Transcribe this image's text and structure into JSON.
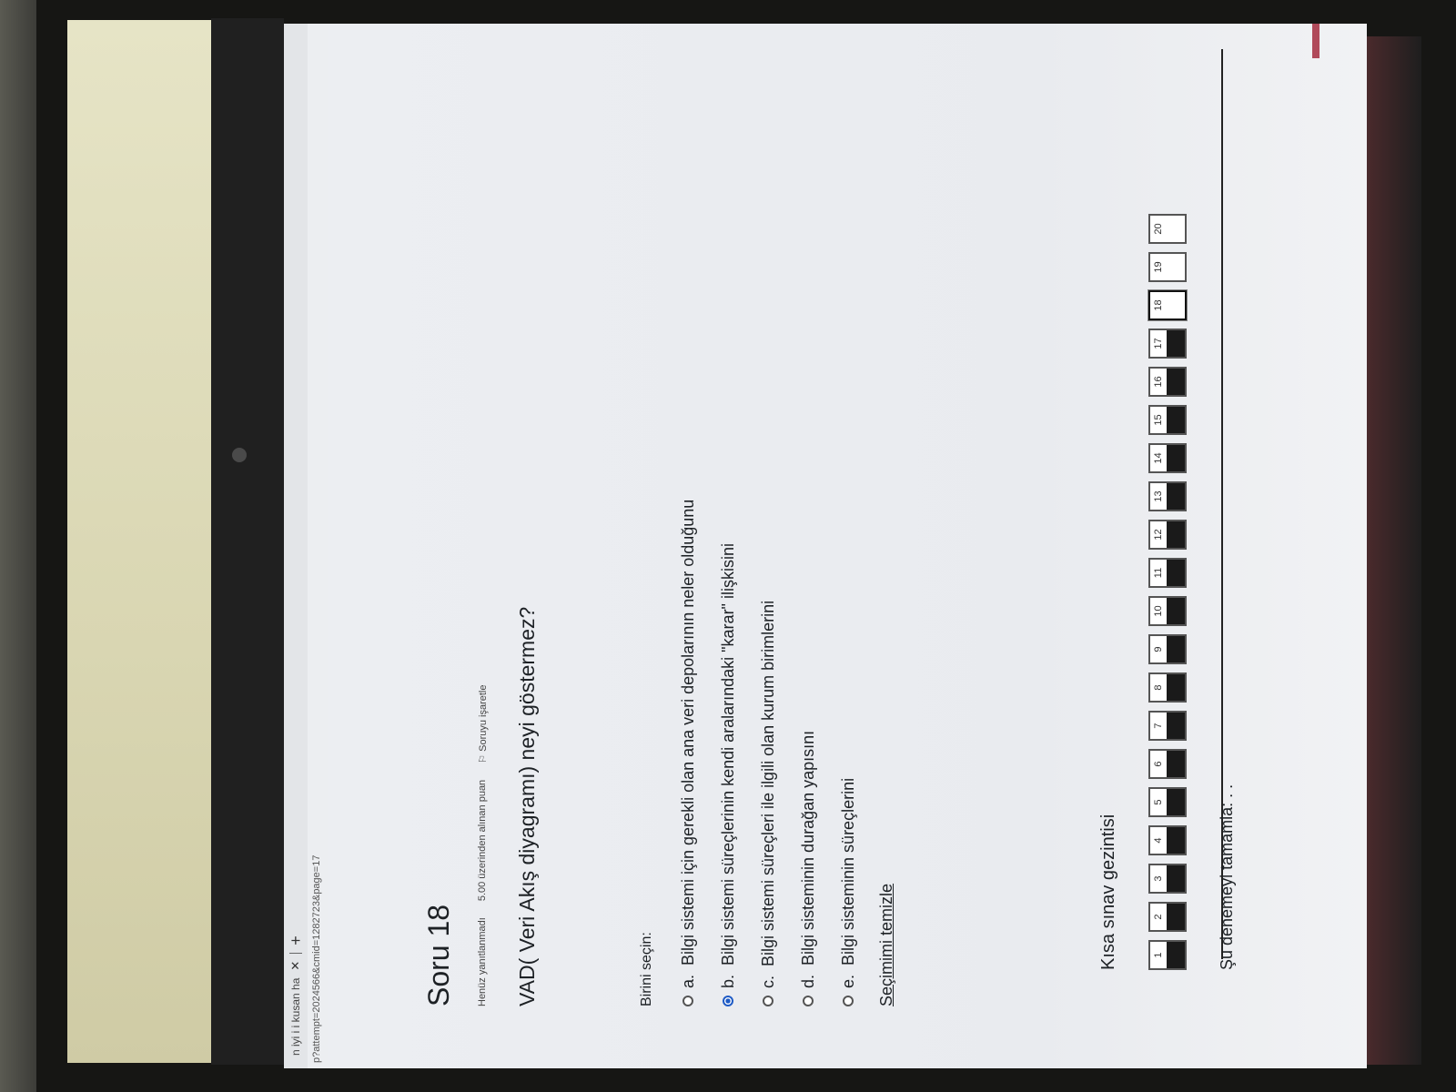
{
  "browser": {
    "tab_title": "n iyi i i kusan ha",
    "tab_close_icon": "close-icon",
    "new_tab_icon": "plus-icon",
    "url": "p?attempt=2024566&cmid=1282723&page=17"
  },
  "question": {
    "title": "Soru 18",
    "status": "Henüz yanıtlanmadı",
    "points": "5.00 üzerinden alınan puan",
    "flag_label": "Soruyu işaretle",
    "flag_icon": "flag-icon",
    "text": "VAD( Veri Akış diyagramı) neyi göstermez?"
  },
  "answers": {
    "prompt": "Birini seçin:",
    "options": [
      {
        "letter": "a.",
        "text": "Bilgi sistemi için gerekli olan ana veri depolarının neler olduğunu",
        "selected": false
      },
      {
        "letter": "b.",
        "text": "Bilgi sistemi süreçlerinin kendi aralarındaki \"karar\" ilişkisini",
        "selected": true
      },
      {
        "letter": "c.",
        "text": "Bilgi sistemi süreçleri ile ilgili olan kurum birimlerini",
        "selected": false
      },
      {
        "letter": "d.",
        "text": "Bilgi sisteminin durağan yapısını",
        "selected": false
      },
      {
        "letter": "e.",
        "text": "Bilgi sisteminin süreçlerini",
        "selected": false
      }
    ],
    "clear_label": "Seçimimi temizle"
  },
  "navigation": {
    "title": "Kısa sınav gezintisi",
    "buttons": [
      {
        "n": "1",
        "answered": true
      },
      {
        "n": "2",
        "answered": true
      },
      {
        "n": "3",
        "answered": true
      },
      {
        "n": "4",
        "answered": true
      },
      {
        "n": "5",
        "answered": true
      },
      {
        "n": "6",
        "answered": true
      },
      {
        "n": "7",
        "answered": true
      },
      {
        "n": "8",
        "answered": true
      },
      {
        "n": "9",
        "answered": true
      },
      {
        "n": "10",
        "answered": true
      },
      {
        "n": "11",
        "answered": true
      },
      {
        "n": "12",
        "answered": true
      },
      {
        "n": "13",
        "answered": true
      },
      {
        "n": "14",
        "answered": true
      },
      {
        "n": "15",
        "answered": true
      },
      {
        "n": "16",
        "answered": true
      },
      {
        "n": "17",
        "answered": true
      },
      {
        "n": "18",
        "answered": false,
        "current": true
      },
      {
        "n": "19",
        "answered": false
      },
      {
        "n": "20",
        "answered": false
      }
    ],
    "finish_label": "Şu denemeyi tamamla: . ."
  },
  "colors": {
    "accent": "#b04a5a",
    "selected_radio": "#1f5bc5"
  }
}
